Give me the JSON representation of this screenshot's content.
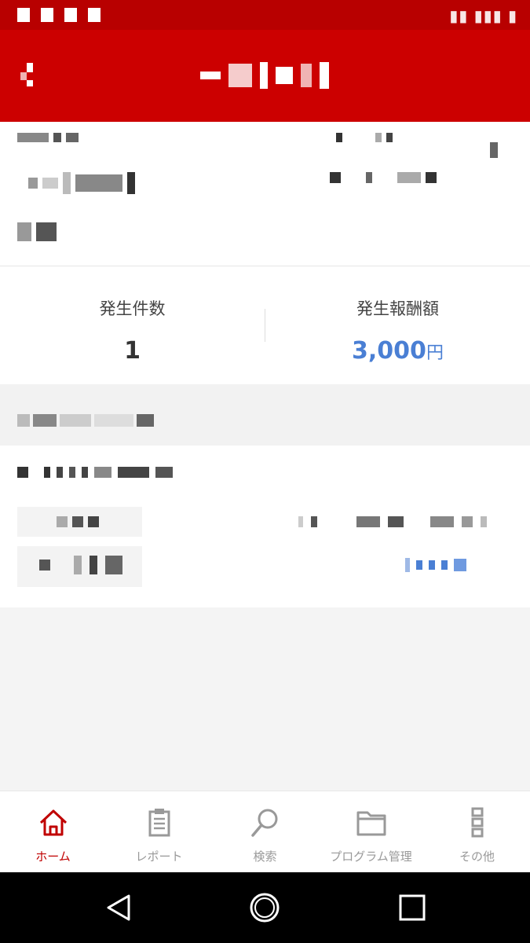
{
  "stats": {
    "count_label": "発生件数",
    "count_value": "1",
    "reward_label": "発生報酬額",
    "reward_value": "3,000",
    "reward_unit": "円"
  },
  "bottom_nav": {
    "items": [
      {
        "label": "ホーム",
        "icon": "home-icon",
        "active": true
      },
      {
        "label": "レポート",
        "icon": "clipboard-icon",
        "active": false
      },
      {
        "label": "検索",
        "icon": "search-icon",
        "active": false
      },
      {
        "label": "プログラム管理",
        "icon": "folder-icon",
        "active": false
      },
      {
        "label": "その他",
        "icon": "more-vertical-icon",
        "active": false
      }
    ]
  },
  "colors": {
    "header": "#cc0000",
    "active_nav": "#c00000",
    "reward_blue": "#4a7fd4"
  }
}
